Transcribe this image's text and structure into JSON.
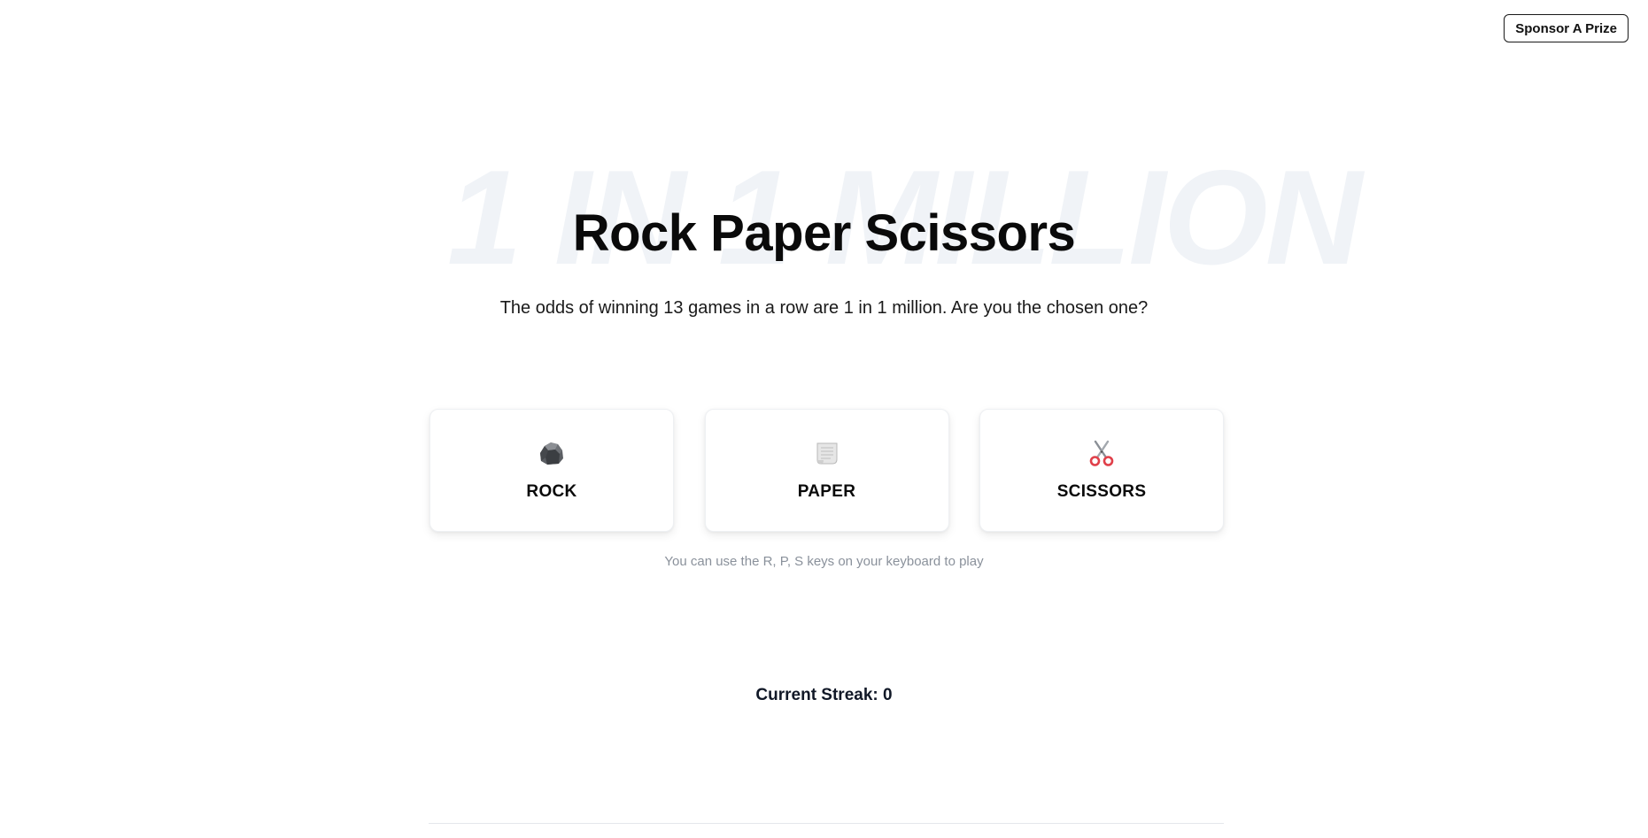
{
  "header": {
    "sponsor_label": "Sponsor A Prize"
  },
  "hero": {
    "watermark": "1 IN 1 MILLION",
    "title": "Rock Paper Scissors",
    "subtitle": "The odds of winning 13 games in a row are 1 in 1 million. Are you the chosen one?"
  },
  "choices": [
    {
      "label": "ROCK",
      "icon": "rock-icon"
    },
    {
      "label": "PAPER",
      "icon": "paper-icon"
    },
    {
      "label": "SCISSORS",
      "icon": "scissors-icon"
    }
  ],
  "hint": "You can use the R, P, S keys on your keyboard to play",
  "streak": {
    "text": "Current Streak: 0"
  },
  "colors": {
    "watermark": "#f0f3f7",
    "hint": "#8a919b",
    "text": "#0a0a0a"
  }
}
